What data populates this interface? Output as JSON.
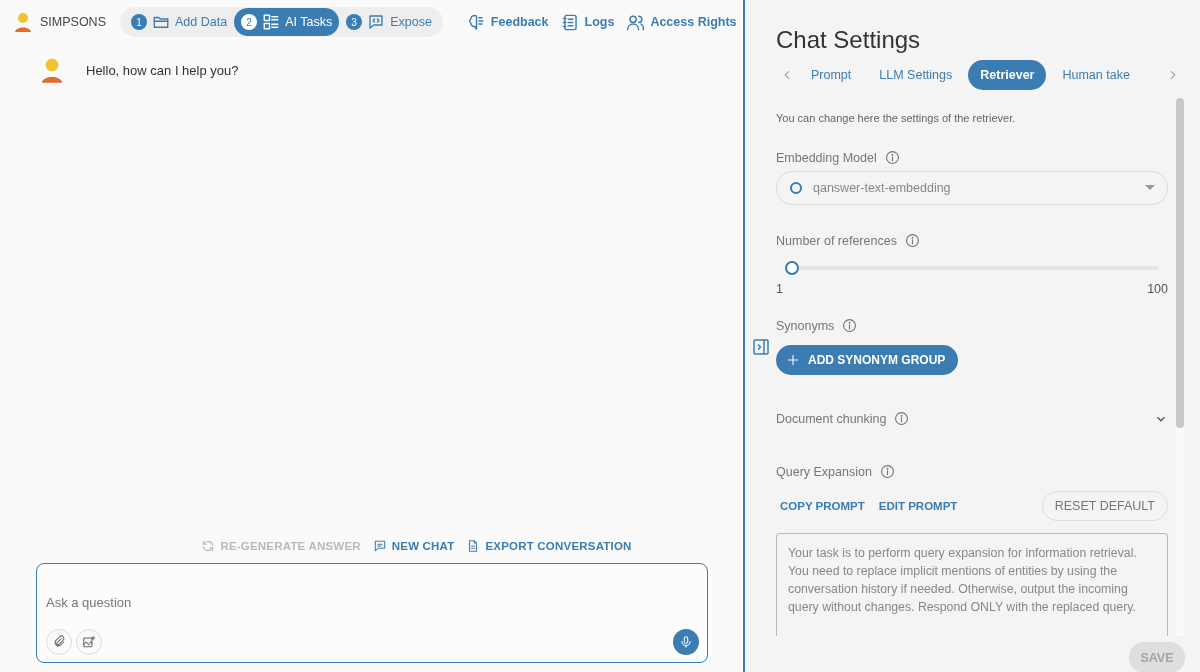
{
  "app": {
    "name": "SIMPSONS"
  },
  "steps": [
    {
      "number": "1",
      "label": "Add Data",
      "selected": false
    },
    {
      "number": "2",
      "label": "AI Tasks",
      "selected": true
    },
    {
      "number": "3",
      "label": "Expose",
      "selected": false
    }
  ],
  "nav_links": [
    "Feedback",
    "Logs",
    "Access Rights"
  ],
  "messages": [
    {
      "text": "Hello, how can I help you?"
    }
  ],
  "chat_actions": [
    {
      "label": "RE-GENERATE ANSWER",
      "disabled": true
    },
    {
      "label": "NEW CHAT",
      "disabled": false
    },
    {
      "label": "EXPORT CONVERSATION",
      "disabled": false
    }
  ],
  "question_field": {
    "placeholder": "Ask a question"
  },
  "settings": {
    "title": "Chat Settings",
    "tabs": [
      {
        "label": "Prompt",
        "selected": false
      },
      {
        "label": "LLM Settings",
        "selected": false
      },
      {
        "label": "Retriever",
        "selected": true
      },
      {
        "label": "Human take",
        "selected": false
      }
    ],
    "description": "You can change here the settings of the retriever.",
    "embedding_model": {
      "label": "Embedding Model",
      "value": "qanswer-text-embedding"
    },
    "references": {
      "label": "Number of references",
      "level": 0,
      "min": "1",
      "max": "100"
    },
    "synonyms": {
      "label": "Synonyms",
      "button": "ADD SYNONYM GROUP"
    },
    "document_chunking": {
      "label": "Document chunking",
      "expanded": false
    },
    "query_expansion": {
      "label": "Query Expansion",
      "actions": [
        "COPY PROMPT",
        "EDIT PROMPT"
      ],
      "reset": "RESET DEFAULT",
      "prompt": "Your task is to perform query expansion for information retrieval. You need to replace implicit mentions of entities by using the conversation history if needed. Otherwise, output the incoming query without changes. Respond ONLY with the replaced query."
    },
    "save": {
      "label": "SAVE",
      "disabled": true
    }
  }
}
